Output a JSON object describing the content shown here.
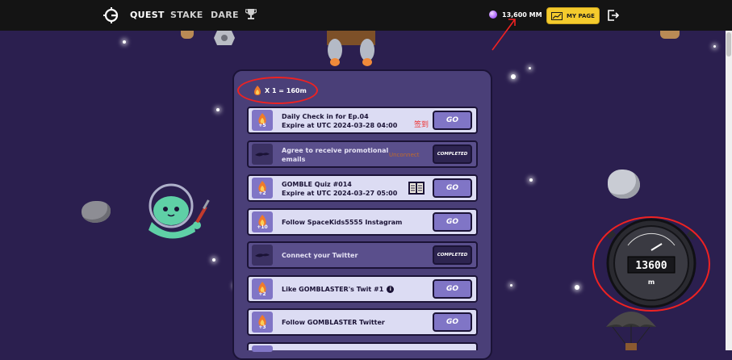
{
  "nav": {
    "items": [
      {
        "label": "QUEST"
      },
      {
        "label": "STAKE"
      },
      {
        "label": "DARE"
      }
    ],
    "trophy_icon": "trophy-icon",
    "balance": "13,600 MM",
    "my_page_label": "MY PAGE"
  },
  "quests": {
    "rate": "X 1 = 160m",
    "rows": [
      {
        "title": "Daily Check in for Ep.04",
        "subtitle": "Expire at UTC 2024-03-28 04:00",
        "points": "+5",
        "action": "GO",
        "note": "签到"
      },
      {
        "title": "Agree to receive promotional",
        "subtitle": "emails",
        "action": "COMPLETED",
        "note": "Unconnect"
      },
      {
        "title": "GOMBLE Quiz #014",
        "subtitle": "Expire at UTC 2024-03-27 05:00",
        "points": "+2",
        "action": "GO"
      },
      {
        "title": "Follow SpaceKids5555 Instagram",
        "points": "+10",
        "action": "GO"
      },
      {
        "title": "Connect your Twitter",
        "action": "COMPLETED"
      },
      {
        "title": "Like GOMBLASTER's Twit #1",
        "points": "+2",
        "action": "GO"
      },
      {
        "title": "Follow GOMBLASTER Twitter",
        "points": "+3",
        "action": "GO"
      }
    ]
  },
  "gauge": {
    "value": "13600",
    "unit": "m"
  },
  "colors": {
    "background": "#2b1f4f",
    "accent": "#8075c6",
    "mypage": "#f4cb2d",
    "annotation": "#e22222"
  }
}
